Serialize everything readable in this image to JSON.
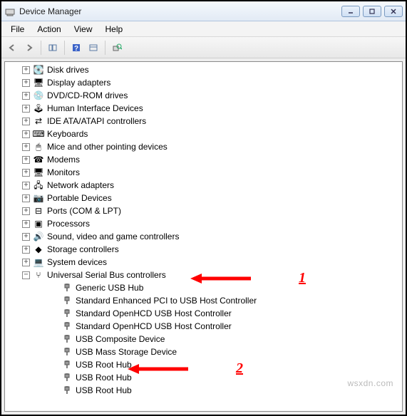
{
  "window": {
    "title": "Device Manager"
  },
  "menu": {
    "file": "File",
    "action": "Action",
    "view": "View",
    "help": "Help"
  },
  "tree": {
    "categories": [
      {
        "label": "Disk drives",
        "icon": "💽",
        "expanded": false
      },
      {
        "label": "Display adapters",
        "icon": "🖥",
        "expanded": false
      },
      {
        "label": "DVD/CD-ROM drives",
        "icon": "💿",
        "expanded": false
      },
      {
        "label": "Human Interface Devices",
        "icon": "🕹",
        "expanded": false
      },
      {
        "label": "IDE ATA/ATAPI controllers",
        "icon": "⇄",
        "expanded": false
      },
      {
        "label": "Keyboards",
        "icon": "⌨",
        "expanded": false
      },
      {
        "label": "Mice and other pointing devices",
        "icon": "🖱",
        "expanded": false
      },
      {
        "label": "Modems",
        "icon": "☎",
        "expanded": false
      },
      {
        "label": "Monitors",
        "icon": "🖥",
        "expanded": false
      },
      {
        "label": "Network adapters",
        "icon": "🖧",
        "expanded": false
      },
      {
        "label": "Portable Devices",
        "icon": "📷",
        "expanded": false
      },
      {
        "label": "Ports (COM & LPT)",
        "icon": "⊟",
        "expanded": false
      },
      {
        "label": "Processors",
        "icon": "▣",
        "expanded": false
      },
      {
        "label": "Sound, video and game controllers",
        "icon": "🔊",
        "expanded": false
      },
      {
        "label": "Storage controllers",
        "icon": "◆",
        "expanded": false
      },
      {
        "label": "System devices",
        "icon": "💻",
        "expanded": false
      },
      {
        "label": "Universal Serial Bus controllers",
        "icon": "⑂",
        "expanded": true
      }
    ],
    "usb_children": [
      {
        "label": "Generic USB Hub"
      },
      {
        "label": "Standard Enhanced PCI to USB Host Controller"
      },
      {
        "label": "Standard OpenHCD USB Host Controller"
      },
      {
        "label": "Standard OpenHCD USB Host Controller"
      },
      {
        "label": "USB Composite Device"
      },
      {
        "label": "USB Mass Storage Device"
      },
      {
        "label": "USB Root Hub"
      },
      {
        "label": "USB Root Hub"
      },
      {
        "label": "USB Root Hub"
      }
    ]
  },
  "annotations": {
    "a1": "1",
    "a2": "2"
  },
  "watermark": "wsxdn.com"
}
